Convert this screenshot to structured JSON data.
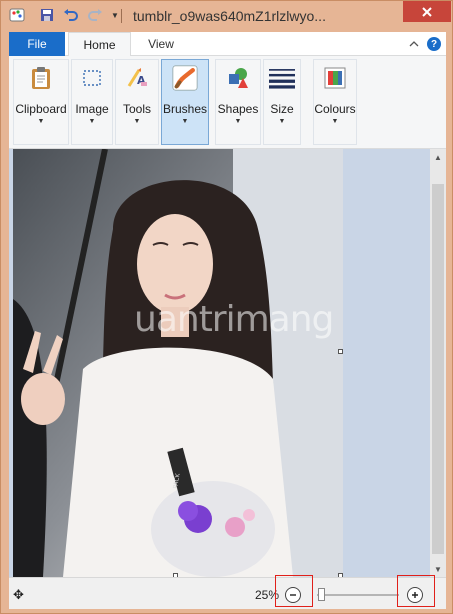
{
  "window": {
    "title": "tumblr_o9was640mZ1rlzlwyo..."
  },
  "tabs": {
    "file": "File",
    "home": "Home",
    "view": "View"
  },
  "ribbon": {
    "groups": [
      {
        "label": "Clipboard",
        "icon": "clipboard-icon"
      },
      {
        "label": "Image",
        "icon": "image-select-icon"
      },
      {
        "label": "Tools",
        "icon": "tools-icon"
      },
      {
        "label": "Brushes",
        "icon": "brush-icon"
      },
      {
        "label": "Shapes",
        "icon": "shapes-icon"
      },
      {
        "label": "Size",
        "icon": "size-icon"
      },
      {
        "label": "Colours",
        "icon": "colours-icon"
      }
    ]
  },
  "status": {
    "zoom": "25%"
  },
  "zoom_level": 0.25,
  "watermark": "uantrimang",
  "colors": {
    "file_tab": "#1a6dc9",
    "title_frame": "#e6b595",
    "close_button": "#c7453a",
    "highlight_box": "#e0201a"
  }
}
